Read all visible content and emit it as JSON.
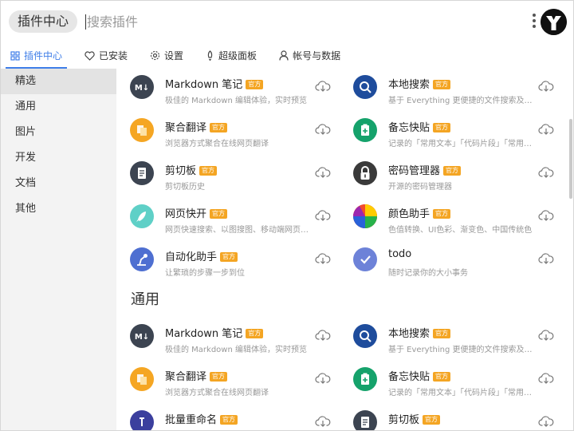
{
  "search": {
    "pill": "插件中心",
    "placeholder": "搜索插件"
  },
  "tabs": [
    {
      "label": "插件中心",
      "icon": "grid-icon"
    },
    {
      "label": "已安装",
      "icon": "heart-icon"
    },
    {
      "label": "设置",
      "icon": "gear-icon"
    },
    {
      "label": "超级面板",
      "icon": "rocket-icon"
    },
    {
      "label": "帐号与数据",
      "icon": "user-icon"
    }
  ],
  "sidebar": [
    {
      "label": "精选"
    },
    {
      "label": "通用"
    },
    {
      "label": "图片"
    },
    {
      "label": "开发"
    },
    {
      "label": "文档"
    },
    {
      "label": "其他"
    }
  ],
  "badge": "官方",
  "sections": [
    {
      "title": "",
      "plugins": [
        {
          "name": "Markdown 笔记",
          "desc": "极佳的 Markdown 编辑体验，实时预览",
          "icon": "markdown-icon",
          "color": "#3c4451"
        },
        {
          "name": "本地搜索",
          "desc": "基于 Everything 更便捷的文件搜索及管理",
          "icon": "search-icon",
          "color": "#1e4c9c"
        },
        {
          "name": "聚合翻译",
          "desc": "浏览器方式聚合在线网页翻译",
          "icon": "translate-icon",
          "color": "#f5a623"
        },
        {
          "name": "备忘快贴",
          "desc": "记录的「常用文本」「代码片段」「常用图片」",
          "icon": "clipboard-plus-icon",
          "color": "#15a26b"
        },
        {
          "name": "剪切板",
          "desc": "剪切板历史",
          "icon": "clipboard-icon",
          "color": "#3c4451"
        },
        {
          "name": "密码管理器",
          "desc": "开源的密码管理器",
          "icon": "lock-icon",
          "color": "#3a3a3a"
        },
        {
          "name": "网页快开",
          "desc": "网页快速搜索、以图搜图、移动端网页打开",
          "icon": "rocket-icon",
          "color": "#5fd0c7"
        },
        {
          "name": "颜色助手",
          "desc": "色值转换、UI色彩、渐变色、中国传统色",
          "icon": "color-wheel-icon",
          "color": "#e84a3a"
        },
        {
          "name": "自动化助手",
          "desc": "让繁琐的步骤一步到位",
          "icon": "robot-arm-icon",
          "color": "#4e6fd1"
        },
        {
          "name": "todo",
          "desc": "随时记录你的大小事务",
          "icon": "check-icon",
          "color": "#6d82d8",
          "official": false
        }
      ]
    },
    {
      "title": "通用",
      "plugins": [
        {
          "name": "Markdown 笔记",
          "desc": "极佳的 Markdown 编辑体验，实时预览",
          "icon": "markdown-icon",
          "color": "#3c4451"
        },
        {
          "name": "本地搜索",
          "desc": "基于 Everything 更便捷的文件搜索及管理",
          "icon": "search-icon",
          "color": "#1e4c9c"
        },
        {
          "name": "聚合翻译",
          "desc": "浏览器方式聚合在线网页翻译",
          "icon": "translate-icon",
          "color": "#f5a623"
        },
        {
          "name": "备忘快贴",
          "desc": "记录的「常用文本」「代码片段」「常用图片」",
          "icon": "clipboard-plus-icon",
          "color": "#15a26b"
        },
        {
          "name": "批量重命名",
          "desc": "",
          "icon": "rename-icon",
          "color": "#3b3f9e"
        },
        {
          "name": "剪切板",
          "desc": "",
          "icon": "clipboard-icon",
          "color": "#3c4451"
        }
      ]
    }
  ]
}
